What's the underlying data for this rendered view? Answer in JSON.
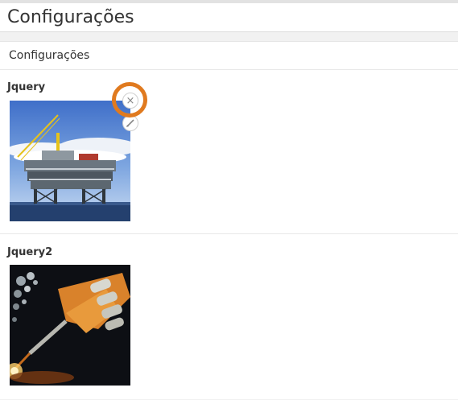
{
  "page": {
    "title": "Configurações"
  },
  "panel": {
    "header": "Configurações"
  },
  "items": [
    {
      "label": "Jquery",
      "image": "offshore-oil-rig-photo",
      "remove_icon": "×"
    },
    {
      "label": "Jquery2",
      "image": "robot-arm-welding-photo"
    }
  ],
  "colors": {
    "highlight": "#e07a1f",
    "background": "#f1f1f1"
  }
}
